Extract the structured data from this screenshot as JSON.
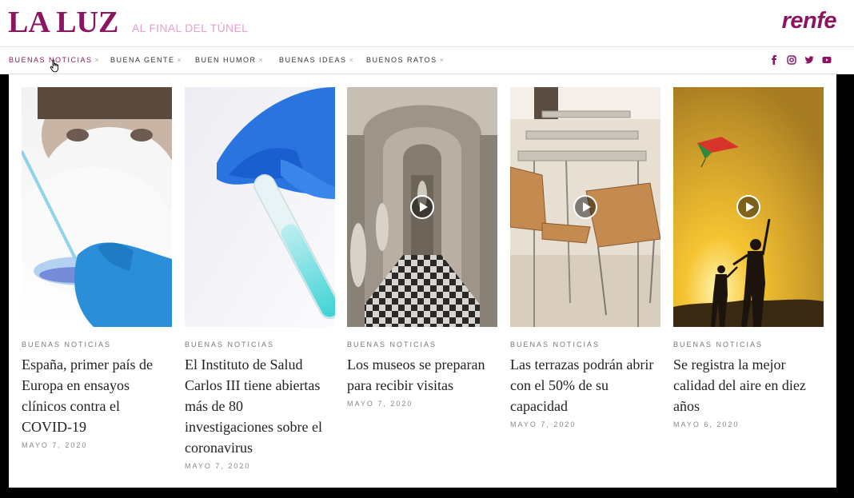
{
  "header": {
    "logo": "LA LUZ",
    "tagline": "AL FINAL DEL TÚNEL",
    "brand": "renfe"
  },
  "nav": {
    "items": [
      {
        "label": "BUENAS NOTICIAS",
        "active": true
      },
      {
        "label": "BUENA GENTE",
        "active": false
      },
      {
        "label": "BUEN HUMOR",
        "active": false
      },
      {
        "label": "BUENAS IDEAS",
        "active": false
      },
      {
        "label": "BUENOS RATOS",
        "active": false
      }
    ],
    "close_symbol": "×",
    "social": [
      "facebook-icon",
      "instagram-icon",
      "twitter-icon",
      "youtube-icon"
    ]
  },
  "articles": [
    {
      "category": "BUENAS NOTICIAS",
      "title": "España, primer país de Europa en ensayos clínicos contra el COVID-19",
      "date": "MAYO 7, 2020",
      "video": false
    },
    {
      "category": "BUENAS NOTICIAS",
      "title": "El Instituto de Salud Carlos III tiene abiertas más de 80 investigaciones sobre el coronavirus",
      "date": "MAYO 7, 2020",
      "video": false
    },
    {
      "category": "BUENAS NOTICIAS",
      "title": "Los museos se preparan para recibir visitas",
      "date": "MAYO 7, 2020",
      "video": true
    },
    {
      "category": "BUENAS NOTICIAS",
      "title": "Las terrazas podrán abrir con el 50% de su capacidad",
      "date": "MAYO 7, 2020",
      "video": true
    },
    {
      "category": "BUENAS NOTICIAS",
      "title": "Se registra la mejor calidad del aire en diez años",
      "date": "MAYO 6, 2020",
      "video": true
    }
  ],
  "colors": {
    "brand": "#8b1560",
    "tagline": "#e6a0d0",
    "background": "#000000"
  }
}
